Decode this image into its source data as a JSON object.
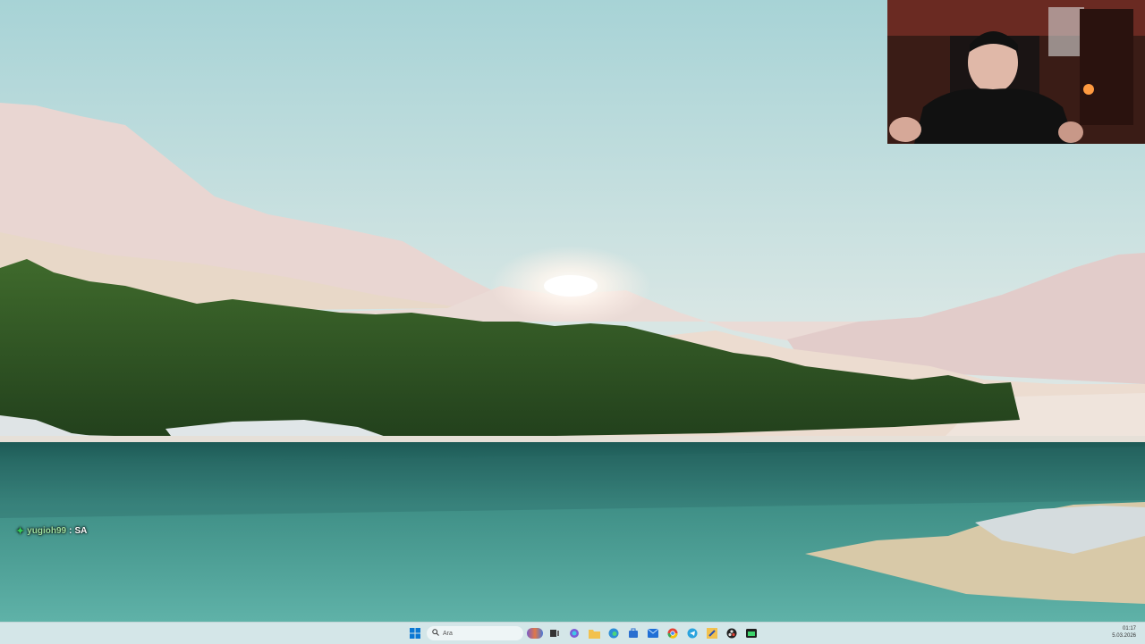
{
  "chat": {
    "username": "yugioh99",
    "separator": ":",
    "message": "SA"
  },
  "taskbar": {
    "search_placeholder": "Ara",
    "pinned_icons": [
      "start-icon",
      "search-icon",
      "widgets-icon",
      "file-explorer-icon",
      "copilot-icon",
      "folder-icon",
      "edge-icon",
      "store-icon",
      "mail-icon",
      "chrome-icon",
      "telegram-icon",
      "sticky-icon",
      "obs-icon",
      "terminal-icon"
    ],
    "clock_time": "01:17",
    "clock_date": "5.03.2026"
  },
  "colors": {
    "taskbar_bg": "#d4e6e8",
    "accent": "#0067c0"
  }
}
